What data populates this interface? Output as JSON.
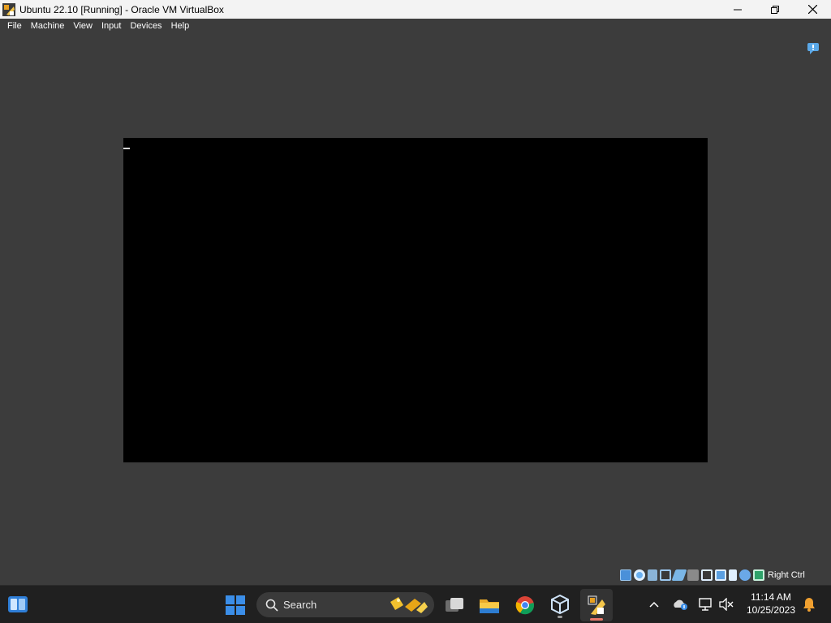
{
  "window": {
    "title": "Ubuntu 22.10 [Running] - Oracle VM VirtualBox"
  },
  "menu": [
    "File",
    "Machine",
    "View",
    "Input",
    "Devices",
    "Help"
  ],
  "statusbar": {
    "host_key": "Right Ctrl",
    "icons": [
      "hard-disk-icon",
      "optical-drive-icon",
      "audio-icon",
      "network-icon",
      "usb-icon",
      "shared-folders-icon",
      "display-icon",
      "recording-icon",
      "virtualization-icon",
      "mouse-integration-icon",
      "keyboard-icon"
    ]
  },
  "taskbar": {
    "search_label": "Search",
    "time": "11:14 AM",
    "date": "10/25/2023"
  },
  "colors": {
    "taskbar_bg": "#202020",
    "window_bg": "#3c3c3c",
    "vm_screen": "#000000",
    "windows_blue": "#3b8ee8",
    "notification_bell": "#f0a030"
  }
}
